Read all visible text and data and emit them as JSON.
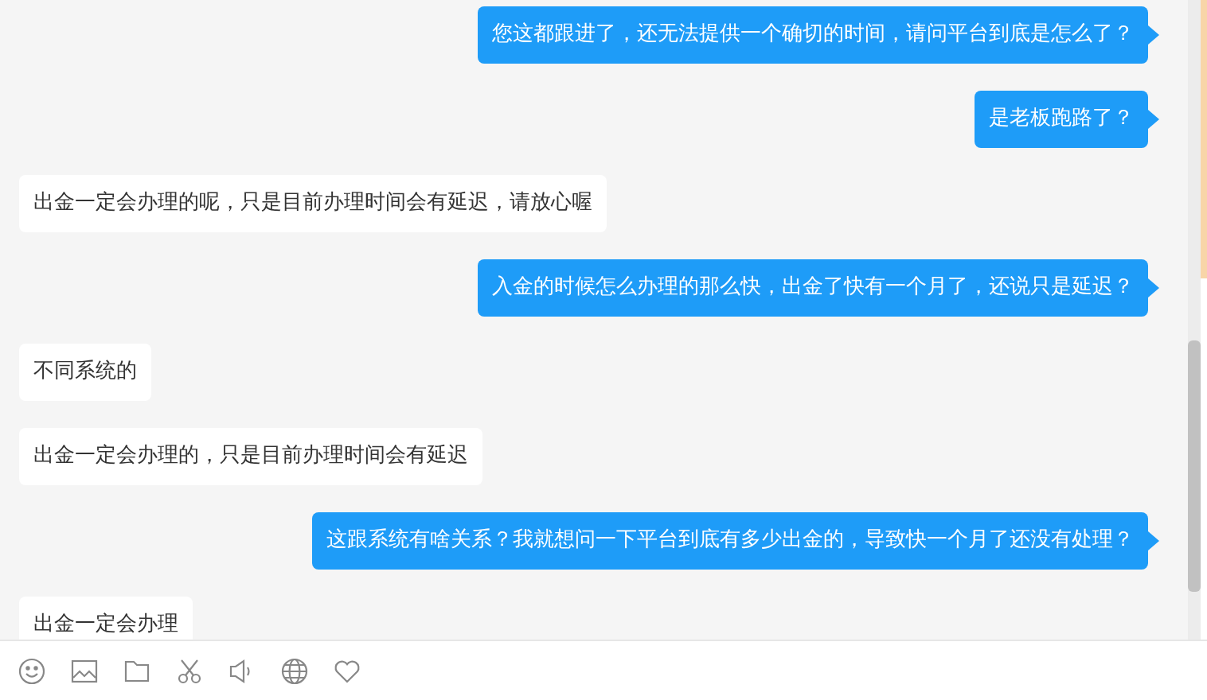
{
  "messages": [
    {
      "kind": "sent",
      "text": "您这都跟进了，还无法提供一个确切的时间，请问平台到底是怎么了？"
    },
    {
      "kind": "sent",
      "text": "是老板跑路了？"
    },
    {
      "kind": "received",
      "text": "出金一定会办理的呢，只是目前办理时间会有延迟，请放心喔"
    },
    {
      "kind": "sent",
      "text": "入金的时候怎么办理的那么快，出金了快有一个月了，还说只是延迟？"
    },
    {
      "kind": "received",
      "text": "不同系统的"
    },
    {
      "kind": "received",
      "text": "出金一定会办理的，只是目前办理时间会有延迟"
    },
    {
      "kind": "sent",
      "text": "这跟系统有啥关系？我就想问一下平台到底有多少出金的，导致快一个月了还没有处理？"
    },
    {
      "kind": "received",
      "text": "出金一定会办理"
    }
  ],
  "toolbar": [
    {
      "kind": "emoji"
    },
    {
      "kind": "image"
    },
    {
      "kind": "file"
    },
    {
      "kind": "scissors"
    },
    {
      "kind": "voice"
    },
    {
      "kind": "globe"
    },
    {
      "kind": "heart"
    }
  ]
}
